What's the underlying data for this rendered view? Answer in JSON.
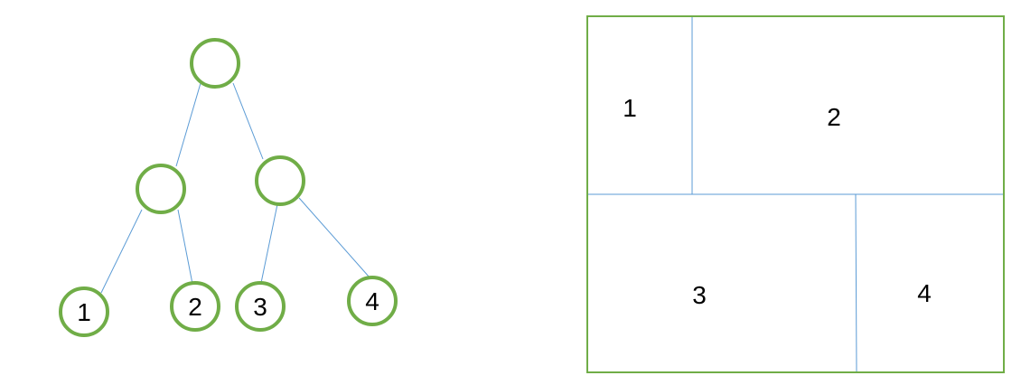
{
  "tree": {
    "node_stroke_color": "#70ad47",
    "edge_color": "#5b9bd5",
    "nodes": [
      {
        "id": "root",
        "label": ""
      },
      {
        "id": "internal-left",
        "label": ""
      },
      {
        "id": "internal-right",
        "label": ""
      },
      {
        "id": "leaf-1",
        "label": "1"
      },
      {
        "id": "leaf-2",
        "label": "2"
      },
      {
        "id": "leaf-3",
        "label": "3"
      },
      {
        "id": "leaf-4",
        "label": "4"
      }
    ],
    "edges": [
      {
        "from": "root",
        "to": "internal-left"
      },
      {
        "from": "root",
        "to": "internal-right"
      },
      {
        "from": "internal-left",
        "to": "leaf-1"
      },
      {
        "from": "internal-left",
        "to": "leaf-2"
      },
      {
        "from": "internal-right",
        "to": "leaf-3"
      },
      {
        "from": "internal-right",
        "to": "leaf-4"
      }
    ]
  },
  "partition": {
    "border_color": "#70ad47",
    "divider_color": "#5b9bd5",
    "regions": [
      {
        "id": "region-1",
        "label": "1"
      },
      {
        "id": "region-2",
        "label": "2"
      },
      {
        "id": "region-3",
        "label": "3"
      },
      {
        "id": "region-4",
        "label": "4"
      }
    ]
  }
}
